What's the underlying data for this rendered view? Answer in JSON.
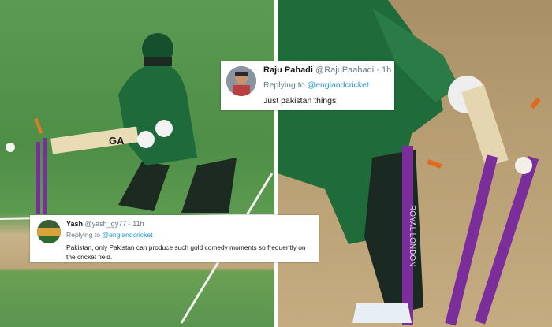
{
  "tweets": [
    {
      "name": "Raju Pahadi",
      "handle": "@RajuPaahadi",
      "time": "1h",
      "reply_prefix": "Replying to",
      "reply_to": "@englandcricket",
      "text": "Just pakistan things"
    },
    {
      "name": "Yash",
      "handle": "@yash_gy77",
      "time": "11h",
      "reply_prefix": "Replying to",
      "reply_to": "@englandcricket",
      "text": "Pakistan, only Pakistan can produce such gold comedy moments so frequently on the cricket field."
    }
  ],
  "photo": {
    "bat_text": "GA",
    "stump_text": "ROYAL LONDON"
  }
}
